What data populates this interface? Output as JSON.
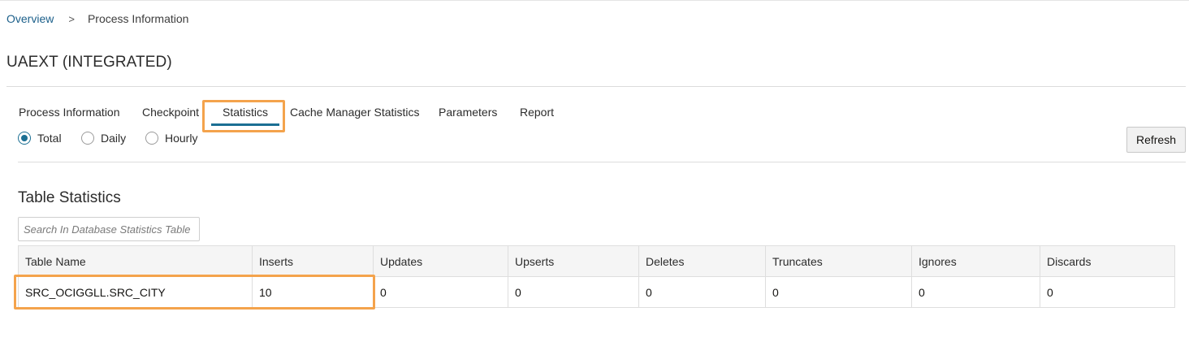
{
  "breadcrumb": {
    "overview": "Overview",
    "separator": ">",
    "current": "Process Information"
  },
  "page_title": "UAEXT (INTEGRATED)",
  "tabs": [
    {
      "label": "Process Information",
      "active": false
    },
    {
      "label": "Checkpoint",
      "active": false
    },
    {
      "label": "Statistics",
      "active": true
    },
    {
      "label": "Cache Manager Statistics",
      "active": false
    },
    {
      "label": "Parameters",
      "active": false
    },
    {
      "label": "Report",
      "active": false
    }
  ],
  "range": {
    "options": [
      "Total",
      "Daily",
      "Hourly"
    ],
    "selected": "Total"
  },
  "refresh_label": "Refresh",
  "table_section": {
    "title": "Table Statistics",
    "search_placeholder": "Search In Database Statistics Table",
    "columns": [
      "Table Name",
      "Inserts",
      "Updates",
      "Upserts",
      "Deletes",
      "Truncates",
      "Ignores",
      "Discards"
    ],
    "rows": [
      [
        "SRC_OCIGGLL.SRC_CITY",
        "10",
        "0",
        "0",
        "0",
        "0",
        "0",
        "0"
      ]
    ]
  },
  "colors": {
    "accent": "#1b6f93",
    "link": "#1b5f8a",
    "highlight": "#f4a34c"
  }
}
